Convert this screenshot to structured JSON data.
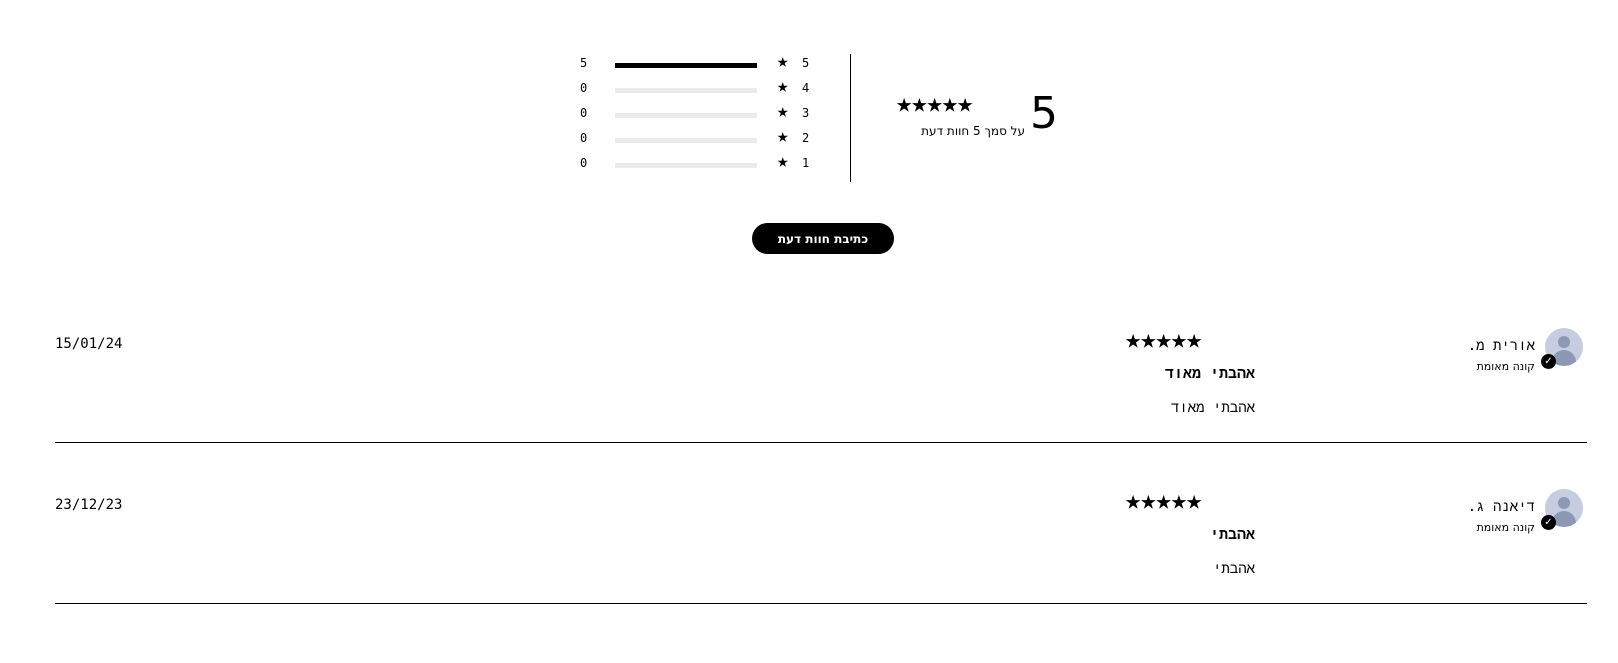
{
  "summary": {
    "average": "5",
    "average_stars": "★★★★★",
    "caption": "על סמך 5 חוות דעת",
    "histogram": [
      {
        "stars": "5",
        "count": "5",
        "fraction": 1.0
      },
      {
        "stars": "4",
        "count": "0",
        "fraction": 0
      },
      {
        "stars": "3",
        "count": "0",
        "fraction": 0
      },
      {
        "stars": "2",
        "count": "0",
        "fraction": 0
      },
      {
        "stars": "1",
        "count": "0",
        "fraction": 0
      }
    ],
    "star_glyph": "★"
  },
  "write_review_label": "כתיבת חוות דעת",
  "reviews": [
    {
      "author": "אורית מ.",
      "badge": "קונה מאומת",
      "rating_stars": "★★★★★",
      "title": "אהבתי מאוד",
      "body": "אהבתי מאוד",
      "date": "15/01/24"
    },
    {
      "author": "דיאנה ג.",
      "badge": "קונה מאומת",
      "rating_stars": "★★★★★",
      "title": "אהבתי",
      "body": "אהבתי",
      "date": "23/12/23"
    }
  ],
  "colors": {
    "accent": "#000000",
    "avatar_bg": "#c6cde0",
    "track": "#ebebeb"
  },
  "icons": {
    "star": "star-icon",
    "verified": "verified-check-icon",
    "avatar": "user-avatar-icon"
  }
}
